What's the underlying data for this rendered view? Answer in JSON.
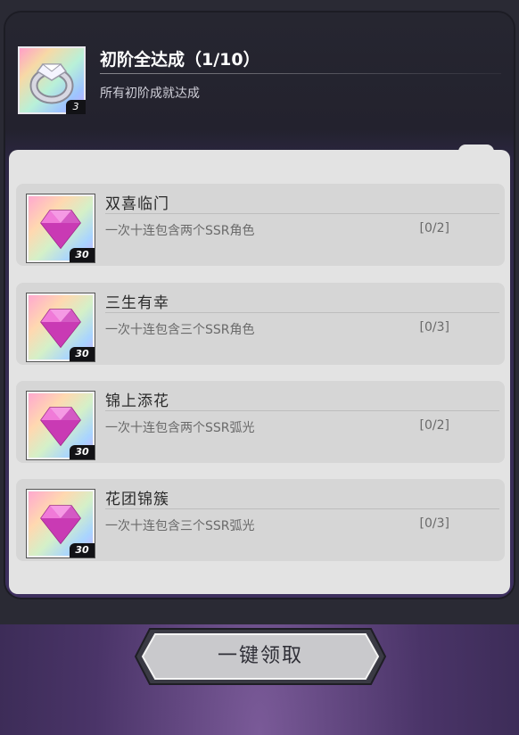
{
  "header": {
    "title": "初阶全达成（1/10）",
    "subtitle": "所有初阶成就达成",
    "reward_count": "3",
    "reward_icon": "ring-icon"
  },
  "achievements": [
    {
      "title": "双喜临门",
      "desc": "一次十连包含两个SSR角色",
      "progress": "[0/2]",
      "reward_count": "30",
      "reward_icon": "gem-icon"
    },
    {
      "title": "三生有幸",
      "desc": "一次十连包含三个SSR角色",
      "progress": "[0/3]",
      "reward_count": "30",
      "reward_icon": "gem-icon"
    },
    {
      "title": "锦上添花",
      "desc": "一次十连包含两个SSR弧光",
      "progress": "[0/2]",
      "reward_count": "30",
      "reward_icon": "gem-icon"
    },
    {
      "title": "花团锦簇",
      "desc": "一次十连包含三个SSR弧光",
      "progress": "[0/3]",
      "reward_count": "30",
      "reward_icon": "gem-icon"
    }
  ],
  "claim_button": {
    "label": "一键领取"
  },
  "colors": {
    "gem": "#e04fc8",
    "panel": "#e3e3e3",
    "item": "#d6d6d6"
  }
}
